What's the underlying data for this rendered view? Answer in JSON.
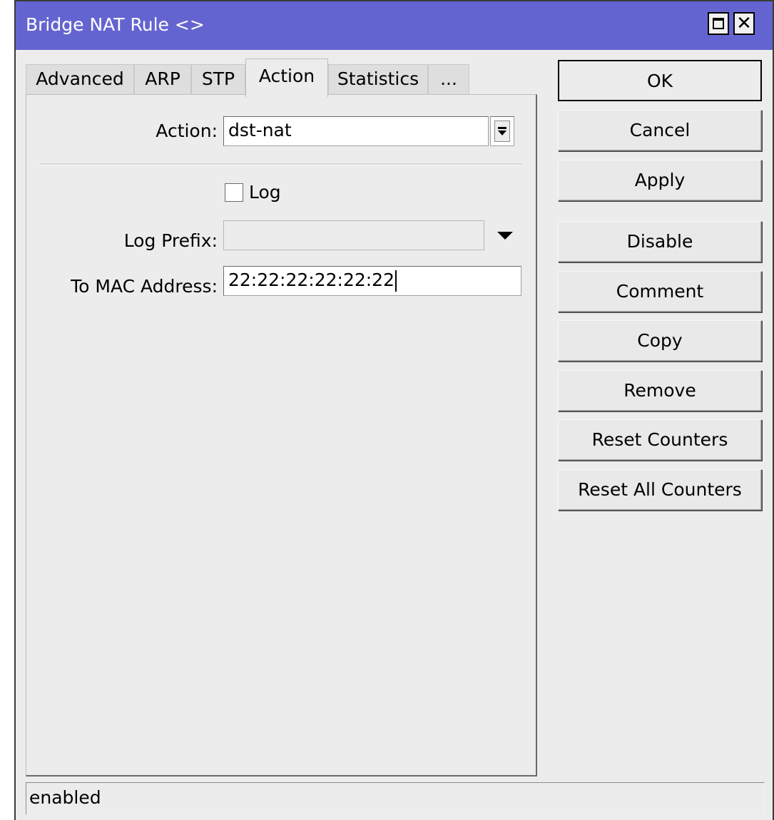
{
  "window": {
    "title": "Bridge NAT Rule <>",
    "maximize_icon": "maximize-icon",
    "close_icon": "close-icon",
    "close_glyph": "✕"
  },
  "tabs": [
    {
      "label": "Advanced",
      "active": false
    },
    {
      "label": "ARP",
      "active": false
    },
    {
      "label": "STP",
      "active": false
    },
    {
      "label": "Action",
      "active": true
    },
    {
      "label": "Statistics",
      "active": false
    },
    {
      "label": "...",
      "active": false
    }
  ],
  "form": {
    "action_label": "Action:",
    "action_value": "dst-nat",
    "log_label": "Log",
    "log_checked": false,
    "log_prefix_label": "Log Prefix:",
    "log_prefix_value": "",
    "to_mac_label": "To MAC Address:",
    "to_mac_value": "22:22:22:22:22:22"
  },
  "buttons": {
    "ok": "OK",
    "cancel": "Cancel",
    "apply": "Apply",
    "disable": "Disable",
    "comment": "Comment",
    "copy": "Copy",
    "remove": "Remove",
    "reset_counters": "Reset Counters",
    "reset_all_counters": "Reset All Counters"
  },
  "status": {
    "text": "enabled"
  },
  "colors": {
    "titlebar": "#6464d1",
    "window_bg": "#ececec"
  }
}
